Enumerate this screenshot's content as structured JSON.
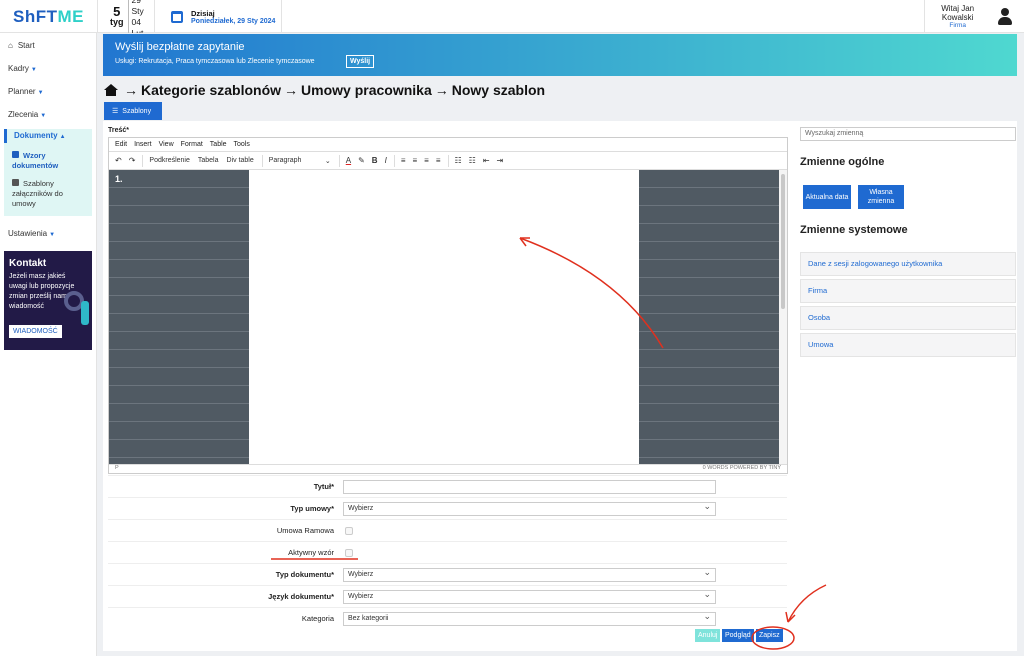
{
  "header": {
    "logo_a": "ShFT",
    "logo_b": "ME",
    "week_num": "5",
    "week_label": "tyg",
    "week_start": "29 Sty",
    "week_end": "04 Lut",
    "today_label": "Dzisiaj",
    "today_date": "Poniedziałek, 29 Sty 2024",
    "user_greeting": "Witaj Jan Kowalski",
    "user_company": "Firma"
  },
  "sidebar": {
    "start": "Start",
    "kadry": "Kadry",
    "planner": "Planner",
    "zlecenia": "Zlecenia",
    "dokumenty": "Dokumenty",
    "wzory": "Wzory dokumentów",
    "szablony": "Szablony załączników do umowy",
    "ustawienia": "Ustawienia",
    "kontakt_title": "Kontakt",
    "kontakt_text": "Jeżeli masz jakieś uwagi lub propozycje zmian prześlij nam wiadomość",
    "kontakt_button": "WIADOMOŚĆ"
  },
  "banner": {
    "title": "Wyślij bezpłatne zapytanie",
    "subtitle": "Usługi: Rekrutacja, Praca tymczasowa lub Zlecenie tymczasowe",
    "button": "Wyślij"
  },
  "breadcrumb": {
    "c1": "Kategorie szablonów",
    "c2": "Umowy pracownika",
    "c3": "Nowy szablon",
    "arrow": "→"
  },
  "tab": {
    "label": "Szablony"
  },
  "editor": {
    "field_label": "Treść*",
    "menu": [
      "Edit",
      "Insert",
      "View",
      "Format",
      "Table",
      "Tools"
    ],
    "toolbar": {
      "podkreslenie": "Podkreślenie",
      "tabela": "Tabela",
      "divtable": "Div table",
      "paragraph": "Paragraph"
    },
    "line_number": "1.",
    "status_left": "P",
    "status_right": "0 WORDS  POWERED BY TINY"
  },
  "variables": {
    "search_placeholder": "Wyszukaj zmienną",
    "ogolne_title": "Zmienne ogólne",
    "btn_aktualna": "Aktualna data",
    "btn_wlasna": "Własna zmienna",
    "systemowe_title": "Zmienne systemowe",
    "items": [
      "Dane z sesji zalogowanego użytkownika",
      "Firma",
      "Osoba",
      "Umowa"
    ]
  },
  "form": {
    "tytul": "Tytuł*",
    "typ_umowy": "Typ umowy*",
    "umowa_ramowa": "Umowa Ramowa",
    "aktywny": "Aktywny wzór",
    "typ_dokumentu": "Typ dokumentu*",
    "jezyk": "Język dokumentu*",
    "kategoria": "Kategoria",
    "wybierz": "Wybierz",
    "bez_kategorii": "Bez kategorii",
    "btn_anuluj": "Anuluj",
    "btn_podglad": "Podgląd",
    "btn_zapisz": "Zapisz"
  },
  "colors": {
    "accent": "#1f6ad1",
    "teal": "#4fd8d0",
    "annotation": "#e0301e"
  }
}
